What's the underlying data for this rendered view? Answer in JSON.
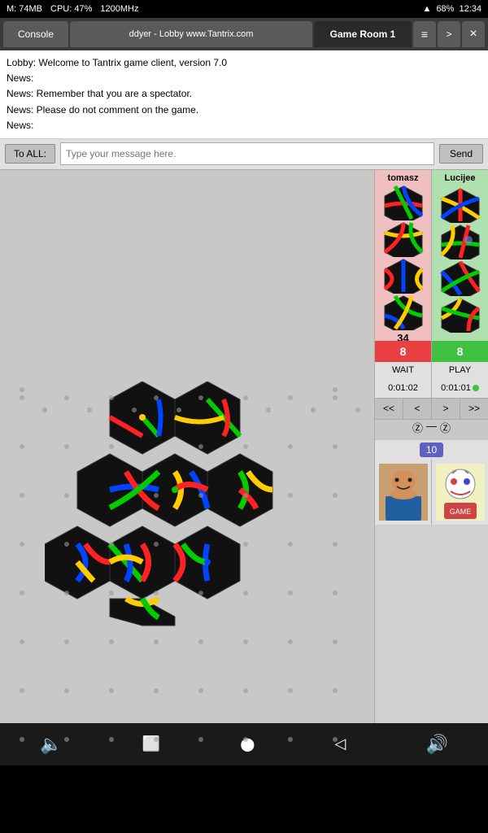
{
  "statusBar": {
    "memLabel": "M: 74MB",
    "cpuLabel": "CPU: 47%",
    "freqLabel": "1200MHz",
    "battery": "68%",
    "time": "12:34",
    "wifiIcon": "wifi",
    "batteryIcon": "battery"
  },
  "tabs": {
    "console": "Console",
    "lobby": "ddyer - Lobby www.Tantrix.com",
    "gameroom": "Game Room 1",
    "menuIcon": "≡",
    "extraIcon": ">",
    "closeIcon": "×"
  },
  "chat": {
    "line1": "Lobby: Welcome to Tantrix game client, version 7.0",
    "line2": "News:",
    "line3": "News: Remember that you are a spectator.",
    "line4": "News: Please do not comment on the game.",
    "line5": "News:"
  },
  "messageInput": {
    "toAllLabel": "To ALL:",
    "placeholder": "Type your message here.",
    "sendLabel": "Send"
  },
  "players": {
    "left": {
      "name": "tomasz",
      "score": "34",
      "scoreNum": "8",
      "status": "WAIT",
      "timer": "0:01:02",
      "timerDot": false
    },
    "right": {
      "name": "Lucijee",
      "score": "",
      "scoreNum": "8",
      "status": "PLAY",
      "timer": "0:01:01",
      "timerDot": true
    }
  },
  "navigation": {
    "btn1": "<<",
    "btn2": "<",
    "btn3": ">",
    "btn4": ">>"
  },
  "symbolRow": {
    "left": "Ⓩ",
    "dash": "—",
    "right": "Ⓩ"
  },
  "counter": {
    "value": "10"
  },
  "bottomBar": {
    "vol": "🔈",
    "home": "⬛",
    "circle": "⬤",
    "back": "◁",
    "volRight": "🔊"
  }
}
